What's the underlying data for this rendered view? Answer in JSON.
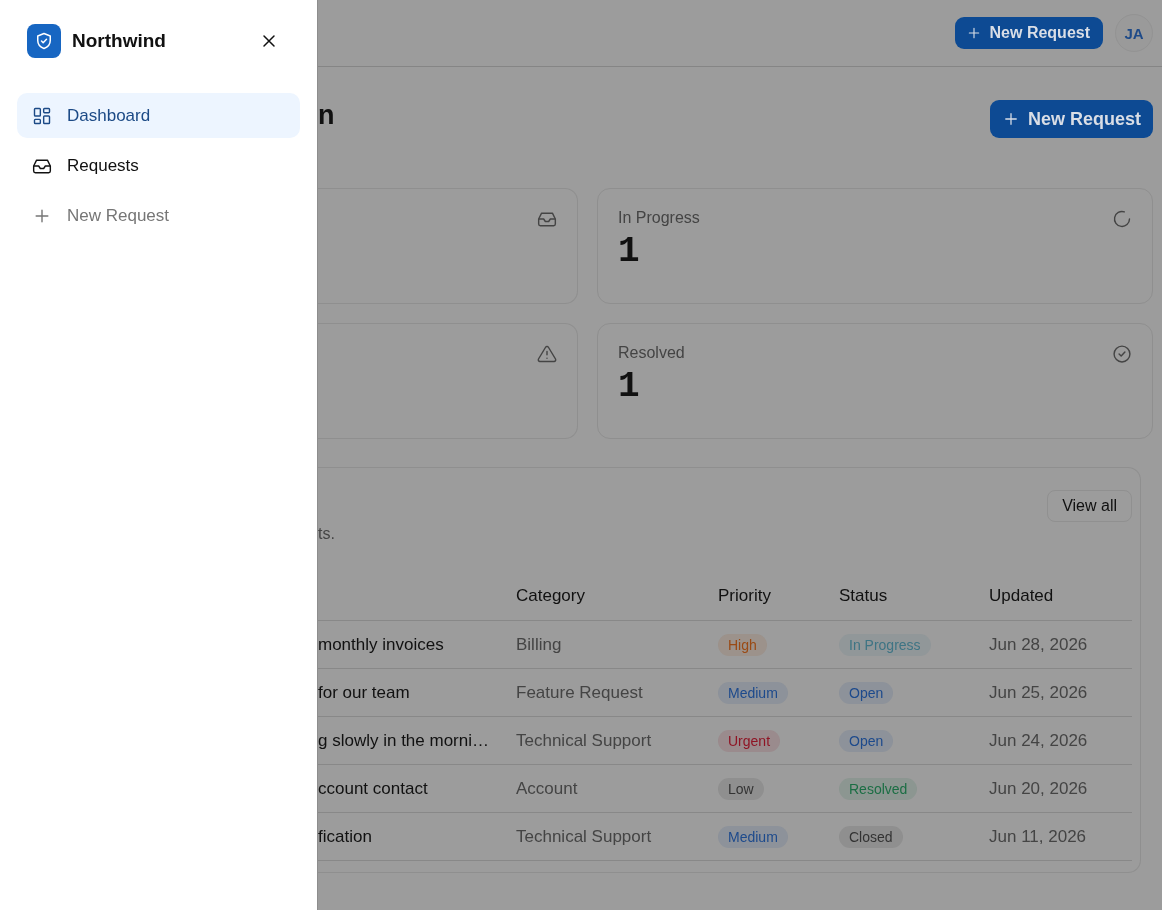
{
  "sidebar": {
    "brand": "Northwind",
    "items": [
      {
        "label": "Dashboard",
        "kind": "link",
        "selected": true
      },
      {
        "label": "Requests",
        "kind": "link",
        "selected": false
      },
      {
        "label": "New Request",
        "kind": "action",
        "selected": false
      }
    ]
  },
  "header": {
    "new_request_button": "New Request",
    "avatar": "JA"
  },
  "page": {
    "title_fragment": "n",
    "new_request_button": "New Request"
  },
  "stat_cards": [
    {
      "kind": "inbox"
    },
    {
      "label": "In Progress",
      "value": "1",
      "kind": "spinner"
    },
    {
      "kind": "warning"
    },
    {
      "label": "Resolved",
      "value": "1",
      "kind": "check-circle"
    }
  ],
  "recent": {
    "subtitle_fragment": "ts.",
    "view_all": "View all",
    "columns": [
      "Category",
      "Priority",
      "Status",
      "Updated"
    ],
    "rows": [
      {
        "subject": "monthly invoices",
        "category": "Billing",
        "priority": {
          "text": "High",
          "color": "#9a4a14"
        },
        "status": {
          "text": "In Progress",
          "color": "#3e7484"
        },
        "updated": "Jun 28, 2026"
      },
      {
        "subject": "for our team",
        "category": "Feature Request",
        "priority": {
          "text": "Medium",
          "color": "#1d4a8c"
        },
        "status": {
          "text": "Open",
          "color": "#1d4a8c"
        },
        "updated": "Jun 25, 2026"
      },
      {
        "subject": "g slowly in the morni…",
        "category": "Technical Support",
        "priority": {
          "text": "Urgent",
          "color": "#8f1424"
        },
        "status": {
          "text": "Open",
          "color": "#1d4a8c"
        },
        "updated": "Jun 24, 2026"
      },
      {
        "subject": "ccount contact",
        "category": "Account",
        "priority": {
          "text": "Low",
          "color": "#333333"
        },
        "status": {
          "text": "Resolved",
          "color": "#1b6e44"
        },
        "updated": "Jun 20, 2026"
      },
      {
        "subject": "fication",
        "category": "Technical Support",
        "priority": {
          "text": "Medium",
          "color": "#1d4a8c"
        },
        "status": {
          "text": "Closed",
          "color": "#333333"
        },
        "updated": "Jun 11, 2026"
      }
    ]
  }
}
